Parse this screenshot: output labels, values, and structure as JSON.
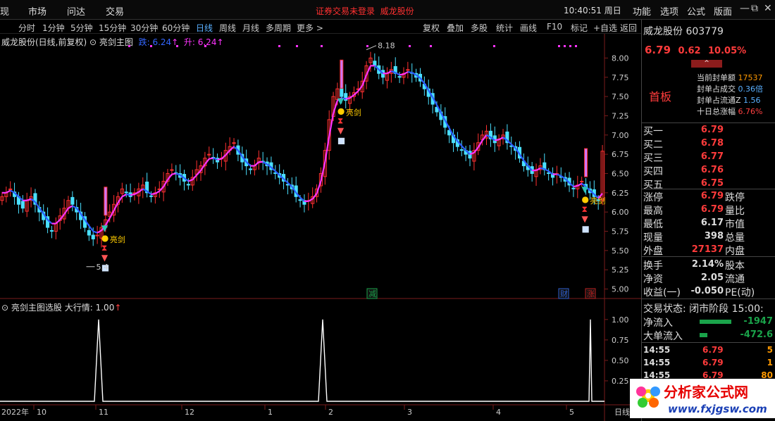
{
  "menu": {
    "items": [
      "现",
      "市场",
      "问达",
      "交易"
    ],
    "alert": "证券交易未登录",
    "alert_stock": "威龙股份",
    "clock": "10:40:51",
    "weekday": "周日",
    "right_items": [
      "功能",
      "选项",
      "公式",
      "版面"
    ],
    "min": "—",
    "max": "⧉",
    "close": "✕"
  },
  "toolbar": {
    "periods": [
      "分时",
      "1分钟",
      "5分钟",
      "15分钟",
      "30分钟",
      "60分钟",
      "日线",
      "周线",
      "月线",
      "多周期",
      "更多 >"
    ],
    "active": "日线",
    "right": [
      "复权",
      "叠加",
      "多股",
      "统计",
      "画线",
      "F10",
      "标记",
      "+自选",
      "返回"
    ]
  },
  "indicator": {
    "stock_title": "威龙股份(日线,前复权)",
    "name": "亮剑主图",
    "fall_label": "跌:",
    "fall_value": "6.24",
    "rise_label": "升:",
    "rise_value": "6.24",
    "up_arrow": "↑"
  },
  "sub_indicator": {
    "name": "亮剑主图选股",
    "label": "大行情:",
    "value": "1.00",
    "arrow": "↑"
  },
  "chart_data": [
    {
      "type": "candlestick",
      "title": "亮剑主图",
      "y_ticks": [
        "8.00",
        "7.75",
        "7.50",
        "7.25",
        "7.00",
        "6.75",
        "6.50",
        "6.25",
        "6.00",
        "5.75",
        "5.50",
        "5.25",
        "5.00"
      ],
      "ylim": [
        4.95,
        8.15
      ],
      "annotations": [
        {
          "text": "8.18",
          "value": 8.18
        },
        {
          "text": "5.4",
          "value": 5.4
        }
      ],
      "markers": [
        {
          "text": "减",
          "color": "#1aa34a"
        },
        {
          "text": "财",
          "color": "#2e5fd0"
        },
        {
          "text": "涨",
          "color": "#c02020"
        }
      ],
      "signal_labels": [
        "亮剑",
        "亮剑",
        "亮剑"
      ],
      "x_ticks": [
        "2022年",
        "10",
        "11",
        "12",
        "1",
        "2",
        "3",
        "4",
        "5"
      ],
      "x_unit": "日线",
      "close": [
        6.2,
        6.25,
        6.3,
        6.2,
        6.1,
        6.05,
        6.15,
        6.2,
        6.1,
        6.0,
        5.9,
        5.8,
        5.75,
        5.85,
        5.95,
        6.05,
        6.15,
        6.1,
        6.0,
        5.9,
        5.8,
        5.7,
        5.65,
        5.7,
        5.8,
        5.9,
        6.0,
        6.1,
        6.2,
        6.3,
        6.25,
        6.2,
        6.25,
        6.3,
        6.35,
        6.25,
        6.2,
        6.25,
        6.3,
        6.4,
        6.5,
        6.55,
        6.5,
        6.45,
        6.4,
        6.35,
        6.45,
        6.55,
        6.6,
        6.7,
        6.75,
        6.7,
        6.65,
        6.7,
        6.8,
        6.85,
        6.9,
        6.75,
        6.65,
        6.6,
        6.55,
        6.6,
        6.7,
        6.65,
        6.6,
        6.55,
        6.5,
        6.45,
        6.4,
        6.35,
        6.3,
        6.2,
        6.15,
        6.1,
        6.15,
        6.2,
        6.3,
        6.5,
        6.8,
        7.2,
        7.5,
        7.6,
        7.5,
        7.45,
        7.5,
        7.55,
        7.6,
        7.7,
        7.9,
        8.0,
        7.9,
        7.8,
        7.75,
        7.8,
        7.85,
        7.8,
        7.75,
        7.8,
        7.85,
        7.8,
        7.75,
        7.7,
        7.6,
        7.5,
        7.4,
        7.3,
        7.2,
        7.1,
        7.0,
        6.9,
        6.85,
        6.8,
        6.75,
        6.7,
        6.8,
        6.9,
        7.0,
        7.05,
        6.95,
        6.9,
        6.95,
        7.0,
        6.9,
        6.85,
        6.8,
        6.7,
        6.6,
        6.55,
        6.5,
        6.55,
        6.6,
        6.55,
        6.5,
        6.45,
        6.5,
        6.45,
        6.4,
        6.35,
        6.3,
        6.35,
        6.4,
        6.3,
        6.25,
        6.2,
        6.15,
        6.79
      ],
      "ma": [
        6.25,
        6.25,
        6.28,
        6.25,
        6.2,
        6.15,
        6.15,
        6.17,
        6.13,
        6.05,
        5.98,
        5.9,
        5.85,
        5.85,
        5.9,
        5.97,
        6.05,
        6.08,
        6.05,
        5.98,
        5.9,
        5.82,
        5.75,
        5.73,
        5.76,
        5.83,
        5.92,
        6.02,
        6.12,
        6.2,
        6.23,
        6.22,
        6.23,
        6.26,
        6.3,
        6.27,
        6.23,
        6.24,
        6.27,
        6.33,
        6.42,
        6.49,
        6.5,
        6.48,
        6.44,
        6.4,
        6.42,
        6.48,
        6.54,
        6.62,
        6.69,
        6.7,
        6.68,
        6.69,
        6.74,
        6.8,
        6.85,
        6.8,
        6.72,
        6.65,
        6.6,
        6.6,
        6.65,
        6.65,
        6.62,
        6.58,
        6.53,
        6.48,
        6.43,
        6.38,
        6.33,
        6.25,
        6.19,
        6.14,
        6.14,
        6.17,
        6.24,
        6.4,
        6.65,
        6.98,
        7.28,
        7.45,
        7.48,
        7.47,
        7.48,
        7.52,
        7.57,
        7.64,
        7.78,
        7.9,
        7.9,
        7.85,
        7.8,
        7.8,
        7.83,
        7.81,
        7.78,
        7.79,
        7.82,
        7.81,
        7.78,
        7.74,
        7.67,
        7.58,
        7.49,
        7.39,
        7.29,
        7.19,
        7.09,
        6.99,
        6.92,
        6.86,
        6.8,
        6.75,
        6.77,
        6.84,
        6.93,
        7.0,
        6.97,
        6.93,
        6.94,
        6.97,
        6.93,
        6.88,
        6.83,
        6.75,
        6.67,
        6.6,
        6.54,
        6.54,
        6.57,
        6.56,
        6.53,
        6.49,
        6.49,
        6.47,
        6.43,
        6.38,
        6.33,
        6.34,
        6.37,
        6.33,
        6.28,
        6.23,
        6.18,
        6.24
      ]
    },
    {
      "type": "line",
      "title": "亮剑主图选股",
      "series_label": "大行情",
      "y_ticks": [
        "1.00",
        "0.75",
        "0.50",
        "0.25"
      ],
      "ylim": [
        0,
        1.05
      ],
      "signal_index": [
        33,
        107,
        184
      ]
    }
  ],
  "side": {
    "name": "威龙股份",
    "code": "603779",
    "price": "6.79",
    "change": "0.62",
    "pct": "10.05%",
    "caret": "^",
    "board": "首板",
    "seal": [
      {
        "label": "当前封单额",
        "value": "17537"
      },
      {
        "label": "封单占成交",
        "value": "0.36倍"
      },
      {
        "label": "封单占流通Z",
        "value": "1.56"
      },
      {
        "label": "十日总涨幅",
        "value": "6.76%"
      }
    ],
    "bids": [
      {
        "label": "买一",
        "value": "6.79"
      },
      {
        "label": "买二",
        "value": "6.78"
      },
      {
        "label": "买三",
        "value": "6.77"
      },
      {
        "label": "买四",
        "value": "6.76"
      },
      {
        "label": "买五",
        "value": "6.75"
      }
    ],
    "stats": [
      {
        "l1": "涨停",
        "v1": "6.79",
        "l2": "跌停"
      },
      {
        "l1": "最高",
        "v1": "6.79",
        "l2": "量比"
      },
      {
        "l1": "最低",
        "v1": "6.17",
        "l2": "市值"
      },
      {
        "l1": "现量",
        "v1": "398",
        "l2": "总量"
      },
      {
        "l1": "外盘",
        "v1": "27137",
        "l2": "内盘"
      }
    ],
    "fund": [
      {
        "l1": "换手",
        "v1": "2.14%",
        "l2": "股本"
      },
      {
        "l1": "净资",
        "v1": "2.05",
        "l2": "流通"
      },
      {
        "l1": "收益(一)",
        "v1": "-0.050",
        "l2": "PE(动)"
      }
    ],
    "trade_state": "交易状态: 闭市阶段",
    "trade_time": "15:00:",
    "flows": [
      {
        "label": "净流入",
        "value": "-1947",
        "bar": 0.8,
        "color": "#1aa34a"
      },
      {
        "label": "大单流入",
        "value": "-472.6",
        "bar": 0.2,
        "color": "#1aa34a"
      }
    ],
    "ticks": [
      {
        "t": "14:55",
        "p": "6.79",
        "v": "5"
      },
      {
        "t": "14:55",
        "p": "6.79",
        "v": "1"
      },
      {
        "t": "14:55",
        "p": "6.79",
        "v": "80"
      }
    ]
  },
  "watermark": {
    "title": "分析家公式网",
    "url": "www.fxjgsw.com"
  }
}
